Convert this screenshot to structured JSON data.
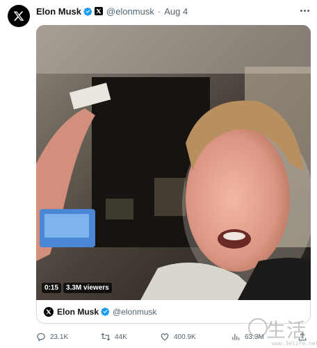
{
  "tweet": {
    "author_name": "Elon Musk",
    "author_handle": "@elonmusk",
    "separator": "·",
    "date": "Aug 4"
  },
  "video": {
    "duration": "0:15",
    "viewers": "3.3M viewers"
  },
  "quoted": {
    "author_name": "Elon Musk",
    "author_handle": "@elonmusk"
  },
  "actions": {
    "replies": "23.1K",
    "retweets": "44K",
    "likes": "400.9K",
    "views": "63.3M"
  },
  "watermark": {
    "text": "生活",
    "url": "www.3elife.net"
  },
  "colors": {
    "verified": "#1d9bf0",
    "secondary_text": "#536471",
    "border": "#cfd9de"
  },
  "icons": [
    "x-logo-icon",
    "verified-icon",
    "more-icon",
    "reply-icon",
    "retweet-icon",
    "like-icon",
    "views-icon",
    "share-icon"
  ]
}
